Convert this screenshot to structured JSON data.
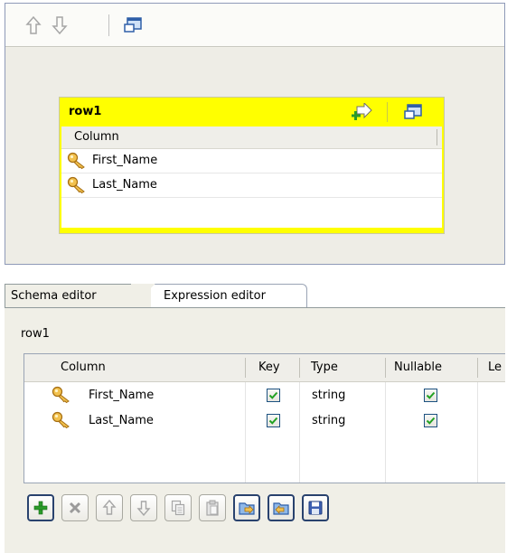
{
  "top_panel": {
    "toolbar": {
      "move_up_icon": "arrow-up-icon",
      "move_down_icon": "arrow-down-icon",
      "window_icon": "window-icon"
    },
    "row_box": {
      "title": "row1",
      "column_header": "Column",
      "rows": [
        {
          "label": "First_Name",
          "icon": "key-icon"
        },
        {
          "label": "Last_Name",
          "icon": "key-icon"
        }
      ]
    }
  },
  "bottom_panel": {
    "tabs": [
      {
        "label": "Schema editor",
        "active": true
      },
      {
        "label": "Expression editor",
        "active": false
      }
    ],
    "schema_name": "row1",
    "table": {
      "columns": [
        "Column",
        "Key",
        "Type",
        "Nullable",
        "Le"
      ],
      "rows": [
        {
          "column": "First_Name",
          "key": true,
          "type": "string",
          "nullable": true
        },
        {
          "column": "Last_Name",
          "key": true,
          "type": "string",
          "nullable": true
        }
      ]
    },
    "toolbar_buttons": [
      {
        "name": "add-button",
        "icon": "plus-icon",
        "enabled": true
      },
      {
        "name": "remove-button",
        "icon": "x-icon",
        "enabled": false
      },
      {
        "name": "move-up-button",
        "icon": "arrow-up-icon",
        "enabled": false
      },
      {
        "name": "move-down-button",
        "icon": "arrow-down-icon",
        "enabled": false
      },
      {
        "name": "copy-button",
        "icon": "copy-icon",
        "enabled": false
      },
      {
        "name": "paste-button",
        "icon": "paste-icon",
        "enabled": false
      },
      {
        "name": "import-button",
        "icon": "import-icon",
        "enabled": true
      },
      {
        "name": "export-button",
        "icon": "export-icon",
        "enabled": true
      },
      {
        "name": "save-button",
        "icon": "save-icon",
        "enabled": true
      }
    ]
  },
  "colors": {
    "row_header": "#ffff00",
    "panel_bg": "#f0efe7",
    "checkbox_check": "#21a121",
    "key_icon": "#e0a020"
  }
}
